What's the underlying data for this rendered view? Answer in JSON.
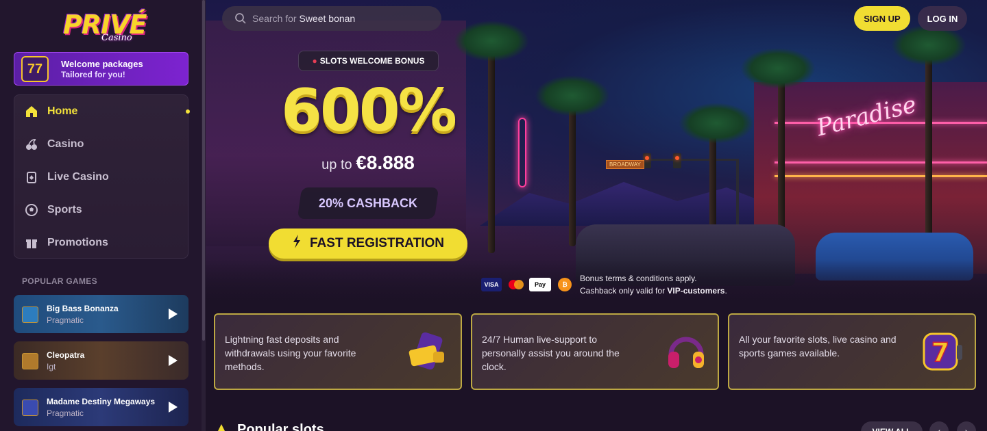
{
  "brand": {
    "logo_word": "PRIVÉ",
    "logo_sub": "Casino"
  },
  "welcome_card": {
    "badge": "77",
    "title": "Welcome packages",
    "subtitle": "Tailored for you!"
  },
  "nav": {
    "items": [
      {
        "label": "Home",
        "icon": "home-icon",
        "active": true
      },
      {
        "label": "Casino",
        "icon": "cherry-icon",
        "active": false
      },
      {
        "label": "Live Casino",
        "icon": "card-icon",
        "active": false
      },
      {
        "label": "Sports",
        "icon": "soccer-ball-icon",
        "active": false
      },
      {
        "label": "Promotions",
        "icon": "gift-icon",
        "active": false
      }
    ]
  },
  "popular_games": {
    "title": "POPULAR GAMES",
    "items": [
      {
        "title": "Big Bass Bonanza",
        "provider": "Pragmatic"
      },
      {
        "title": "Cleopatra",
        "provider": "Igt"
      },
      {
        "title": "Madame Destiny Megaways",
        "provider": "Pragmatic"
      }
    ]
  },
  "header": {
    "search_placeholder": "Search for",
    "search_suggestion": "Sweet bonan",
    "signup_label": "SIGN UP",
    "login_label": "LOG IN"
  },
  "hero": {
    "bonus_pill": "SLOTS WELCOME BONUS",
    "percent": "600%",
    "up_to_prefix": "up to",
    "up_to_amount": "€8.888",
    "cashback": "20% CASHBACK",
    "cta": "FAST REGISTRATION",
    "street_sign": "BROADWAY",
    "neon_sign": "Paradise",
    "payments": [
      "VISA",
      "mastercard",
      "Pay",
      "bitcoin"
    ],
    "terms_line1": "Bonus terms & conditions apply.",
    "terms_line2_prefix": "Cashback only valid for",
    "terms_line2_bold": "VIP-customers",
    "terms_line2_suffix": "."
  },
  "features": [
    {
      "text": "Lightning fast deposits and withdrawals using your favorite methods.",
      "icon": "wallet-phone-icon"
    },
    {
      "text": "24/7 Human live-support to personally assist you around the clock.",
      "icon": "headset-icon"
    },
    {
      "text": "All your favorite slots, live casino and sports games available.",
      "icon": "slot-seven-icon"
    }
  ],
  "popular_slots": {
    "title": "Popular slots",
    "view_all": "VIEW ALL"
  },
  "colors": {
    "accent_yellow": "#f1dd32",
    "bg": "#1c1226",
    "sidebar": "#22162d",
    "purple": "#7d23d0"
  }
}
